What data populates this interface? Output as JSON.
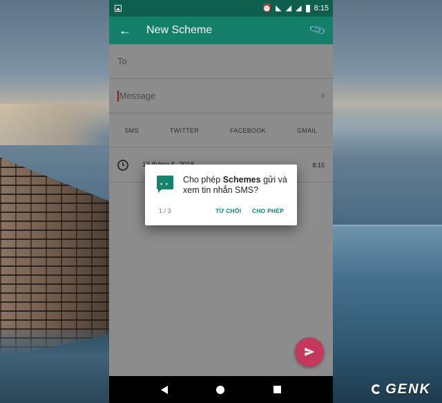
{
  "status_bar": {
    "time": "8:15",
    "icons": [
      "image-notification-icon",
      "alarm-icon",
      "wifi-icon",
      "signal-icon",
      "signal-icon",
      "battery-icon"
    ]
  },
  "app_bar": {
    "title": "New Scheme",
    "back_icon": "arrow-back-icon",
    "attach_icon": "paperclip-icon"
  },
  "compose": {
    "to_placeholder": "To",
    "message_placeholder": "Message",
    "char_count": "0"
  },
  "tabs": [
    "SMS",
    "TWITTER",
    "FACEBOOK",
    "GMAIL"
  ],
  "schedule": {
    "date": "13 tháng 6, 2018",
    "time": "8:15"
  },
  "dialog": {
    "text_before": "Cho phép ",
    "app_name": "Schemes",
    "text_after": " gửi và xem tin nhắn SMS?",
    "step": "1 / 3",
    "deny_label": "TỪ CHỐI",
    "allow_label": "CHO PHÉP"
  },
  "watermark": "GENK",
  "colors": {
    "status_bar": "#0f5f4f",
    "app_bar": "#14806a",
    "accent": "#16836c",
    "fab": "#c4385e"
  }
}
